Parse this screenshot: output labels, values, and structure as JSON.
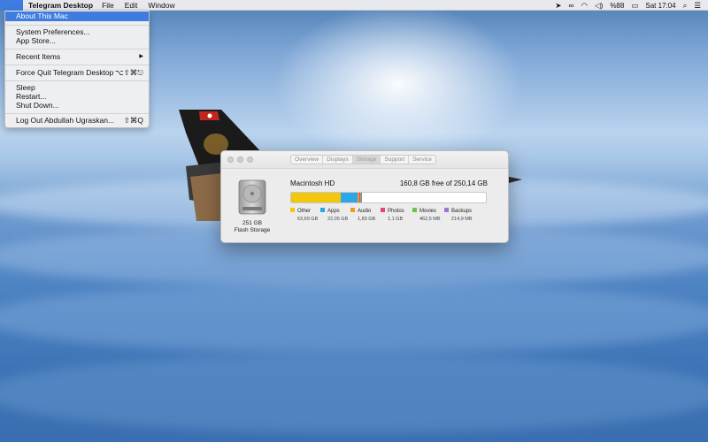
{
  "menubar": {
    "app_name": "Telegram Desktop",
    "items": [
      "File",
      "Edit",
      "Window"
    ],
    "battery": "%88",
    "clock": "Sat 17:04"
  },
  "apple_menu": {
    "items": [
      {
        "label": "About This Mac",
        "shortcut": "",
        "active": true
      },
      {
        "label": "System Preferences...",
        "shortcut": ""
      },
      {
        "label": "App Store...",
        "shortcut": ""
      },
      {
        "label": "Recent Items",
        "shortcut": "▶"
      },
      {
        "label": "Force Quit Telegram Desktop",
        "shortcut": "⌥⇧⌘⎋"
      },
      {
        "label": "Sleep",
        "shortcut": ""
      },
      {
        "label": "Restart...",
        "shortcut": ""
      },
      {
        "label": "Shut Down...",
        "shortcut": ""
      },
      {
        "label": "Log Out Abdullah Ugraskan...",
        "shortcut": "⇧⌘Q"
      }
    ]
  },
  "about_window": {
    "tabs": [
      "Overview",
      "Displays",
      "Storage",
      "Support",
      "Service"
    ],
    "selected_tab": "Storage",
    "disk_capacity": "251 GB",
    "disk_type": "Flash Storage",
    "disk_name": "Macintosh HD",
    "free_text": "160,8 GB free of 250,14 GB",
    "categories": [
      {
        "name": "Other",
        "size": "63,69 GB",
        "color": "#f4c70f",
        "gb": 63.69
      },
      {
        "name": "Apps",
        "size": "22,05 GB",
        "color": "#2aa7e8",
        "gb": 22.05
      },
      {
        "name": "Audio",
        "size": "1,83 GB",
        "color": "#f29a1d",
        "gb": 1.83
      },
      {
        "name": "Photos",
        "size": "1,1 GB",
        "color": "#e8466c",
        "gb": 1.1
      },
      {
        "name": "Movies",
        "size": "462,5 MB",
        "color": "#6cc24a",
        "gb": 0.46
      },
      {
        "name": "Backups",
        "size": "214,9 MB",
        "color": "#9b74d9",
        "gb": 0.21
      }
    ],
    "total_gb": 250.14
  }
}
